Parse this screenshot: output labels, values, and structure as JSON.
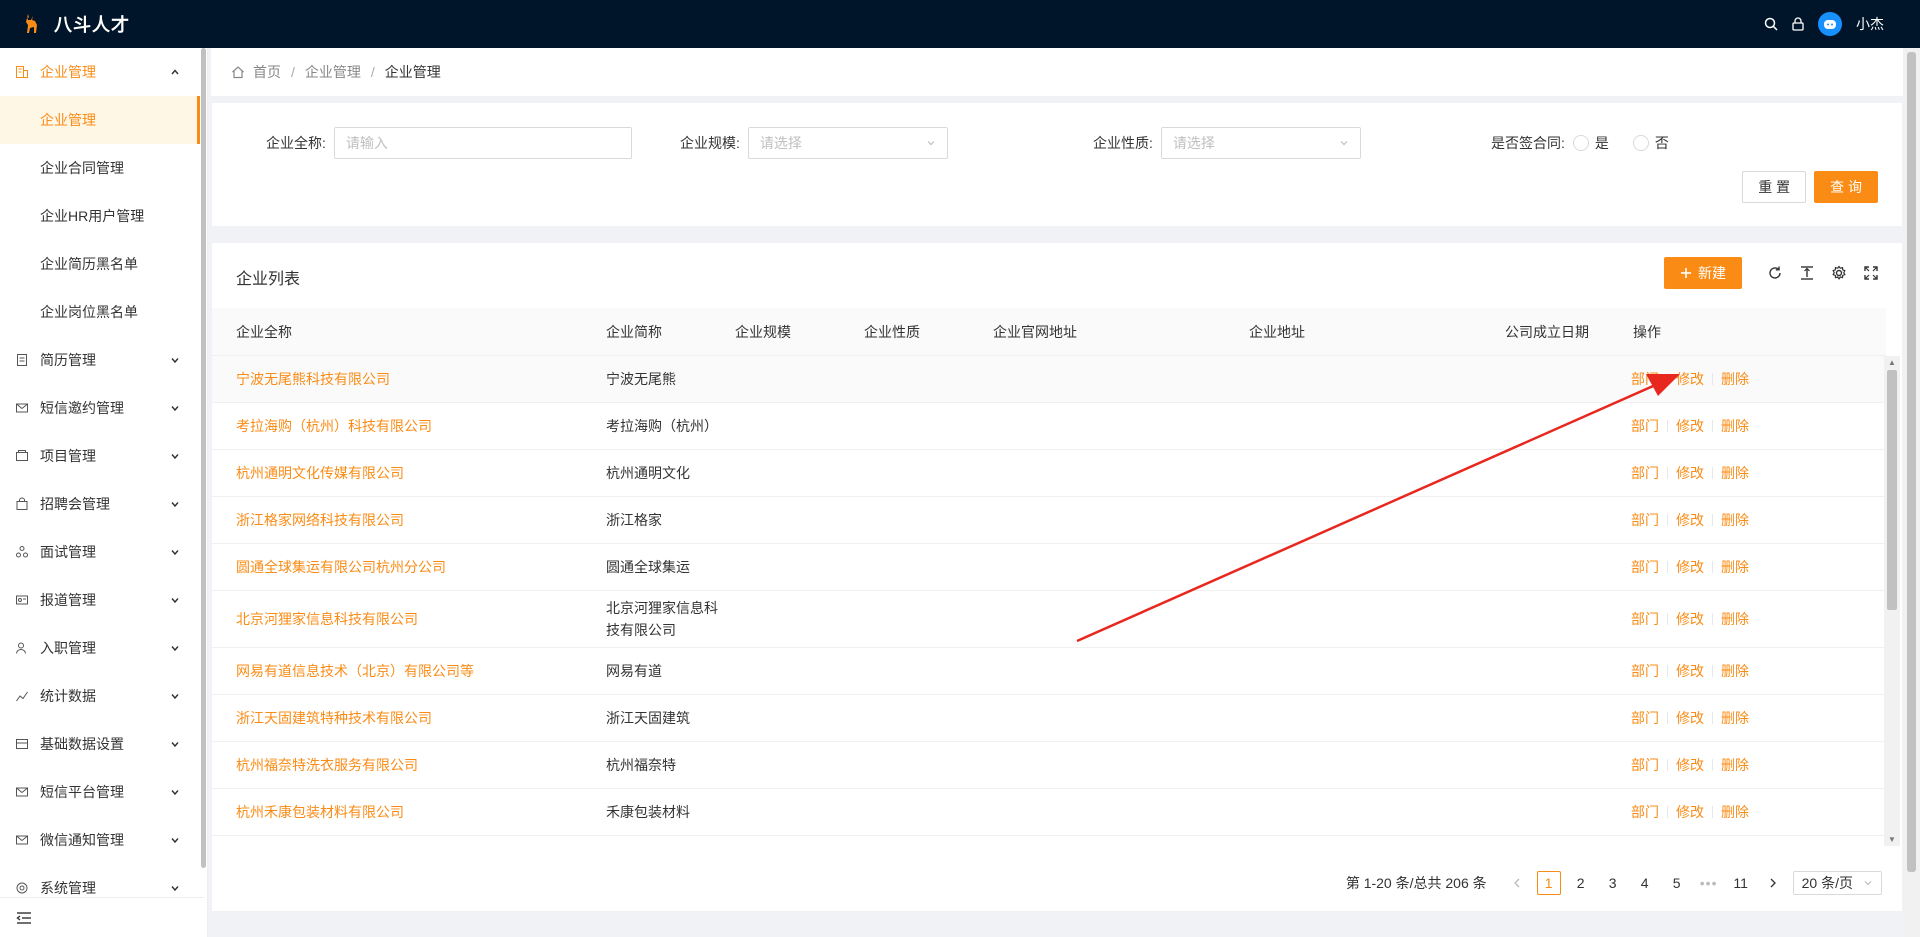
{
  "app": {
    "name": "八斗人才"
  },
  "user": {
    "name": "小杰"
  },
  "colors": {
    "accent": "#fa8c16",
    "header_bg": "#001529",
    "annotation": "#e8271f"
  },
  "sidebar": {
    "groups": [
      {
        "label": "企业管理",
        "icon": "building-icon",
        "open": true,
        "items": [
          {
            "label": "企业管理",
            "active": true
          },
          {
            "label": "企业合同管理"
          },
          {
            "label": "企业HR用户管理"
          },
          {
            "label": "企业简历黑名单"
          },
          {
            "label": "企业岗位黑名单"
          }
        ]
      },
      {
        "label": "简历管理",
        "icon": "file-icon"
      },
      {
        "label": "短信邀约管理",
        "icon": "mail-icon"
      },
      {
        "label": "项目管理",
        "icon": "project-icon"
      },
      {
        "label": "招聘会管理",
        "icon": "bag-icon"
      },
      {
        "label": "面试管理",
        "icon": "apps-icon"
      },
      {
        "label": "报道管理",
        "icon": "idcard-icon"
      },
      {
        "label": "入职管理",
        "icon": "user-icon"
      },
      {
        "label": "统计数据",
        "icon": "chart-icon"
      },
      {
        "label": "基础数据设置",
        "icon": "database-icon"
      },
      {
        "label": "短信平台管理",
        "icon": "message-icon"
      },
      {
        "label": "微信通知管理",
        "icon": "wechat-icon"
      },
      {
        "label": "系统管理",
        "icon": "setting-icon"
      }
    ]
  },
  "breadcrumb": {
    "home": "首页",
    "level1": "企业管理",
    "current": "企业管理"
  },
  "filters": {
    "name_label": "企业全称:",
    "name_placeholder": "请输入",
    "scale_label": "企业规模:",
    "scale_placeholder": "请选择",
    "nature_label": "企业性质:",
    "nature_placeholder": "请选择",
    "contract_label": "是否签合同:",
    "contract_yes": "是",
    "contract_no": "否",
    "reset_label": "重 置",
    "query_label": "查 询"
  },
  "table": {
    "title": "企业列表",
    "new_label": "新建",
    "columns": [
      "企业全称",
      "企业简称",
      "企业规模",
      "企业性质",
      "企业官网地址",
      "企业地址",
      "公司成立日期",
      "操作"
    ],
    "actions": {
      "dept": "部门",
      "edit": "修改",
      "delete": "删除"
    },
    "rows": [
      {
        "name": "宁波无尾熊科技有限公司",
        "short": "宁波无尾熊"
      },
      {
        "name": "考拉海购（杭州）科技有限公司",
        "short": "考拉海购（杭州）"
      },
      {
        "name": "杭州通明文化传媒有限公司",
        "short": "杭州通明文化"
      },
      {
        "name": "浙江格家网络科技有限公司",
        "short": "浙江格家"
      },
      {
        "name": "圆通全球集运有限公司杭州分公司",
        "short": "圆通全球集运"
      },
      {
        "name": "北京河狸家信息科技有限公司",
        "short": "北京河狸家信息科技有限公司",
        "tall": true
      },
      {
        "name": "网易有道信息技术（北京）有限公司等",
        "short": "网易有道"
      },
      {
        "name": "浙江天固建筑特种技术有限公司",
        "short": "浙江天固建筑"
      },
      {
        "name": "杭州福奈特洗衣服务有限公司",
        "short": "杭州福奈特"
      },
      {
        "name": "杭州禾康包装材料有限公司",
        "short": "禾康包装材料"
      }
    ]
  },
  "pagination": {
    "summary": "第 1-20 条/总共 206 条",
    "pages": [
      "1",
      "2",
      "3",
      "4",
      "5"
    ],
    "ellipsis": "•••",
    "last": "11",
    "size": "20 条/页"
  }
}
